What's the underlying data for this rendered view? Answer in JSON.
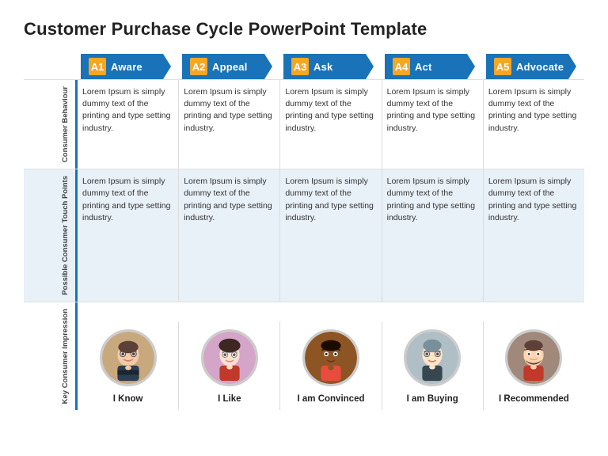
{
  "title": "Customer Purchase Cycle PowerPoint Template",
  "stages": [
    {
      "id": "A1",
      "label": "Aware"
    },
    {
      "id": "A2",
      "label": "Appeal"
    },
    {
      "id": "A3",
      "label": "Ask"
    },
    {
      "id": "A4",
      "label": "Act"
    },
    {
      "id": "A5",
      "label": "Advocate"
    }
  ],
  "sections": [
    {
      "key": "consumer-behaviour",
      "label": "Consumer Behaviour",
      "highlight": false,
      "cells": [
        "Lorem Ipsum is simply dummy text of the printing and type setting industry.",
        "Lorem Ipsum is simply dummy text of the printing and type setting industry.",
        "Lorem Ipsum is simply dummy text of the printing and type setting industry.",
        "Lorem Ipsum is simply dummy text of the printing and type setting industry.",
        "Lorem Ipsum is simply dummy text of the printing and type setting industry."
      ]
    },
    {
      "key": "touch-points",
      "label": "Possible Consumer Touch Points",
      "highlight": true,
      "cells": [
        "Lorem Ipsum is simply dummy text of the printing and  type setting industry.",
        "Lorem Ipsum is simply dummy text of the printing and type setting industry.",
        "Lorem Ipsum is simply dummy text of the printing and type setting industry.",
        "Lorem Ipsum is simply dummy text of the printing and type setting industry.",
        "Lorem Ipsum is simply dummy text of the printing and type setting industry."
      ]
    }
  ],
  "impressions": [
    {
      "label": "I Know",
      "avatar": "person1"
    },
    {
      "label": "I Like",
      "avatar": "person2"
    },
    {
      "label": "I am Convinced",
      "avatar": "person3"
    },
    {
      "label": "I am Buying",
      "avatar": "person4"
    },
    {
      "label": "I Recommended",
      "avatar": "person5"
    }
  ],
  "impression_row_label": "Key Consumer Impression",
  "colors": {
    "primary": "#1a73b8",
    "accent": "#f5a623"
  }
}
